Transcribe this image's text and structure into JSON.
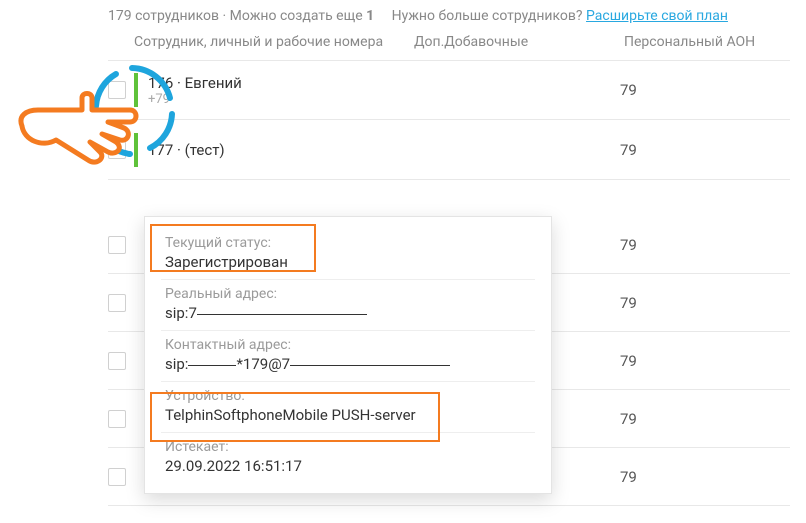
{
  "topInfo": {
    "employees_count": "179 сотрудников",
    "can_create": "Можно создать еще",
    "can_create_num": "1",
    "need_more": "Нужно больше сотрудников?",
    "expand_link": "Расширьте свой план"
  },
  "headers": {
    "employee": "Сотрудник, личный и рабочие номера",
    "ext": "Доп.Добавочные",
    "aon": "Персональный АОН"
  },
  "rows": [
    {
      "title": "176 · Евгений",
      "sub": "+79",
      "aon": "79"
    },
    {
      "title": "177 · (тест)",
      "sub": "",
      "aon": "79"
    }
  ],
  "bg_aon": [
    "79",
    "79",
    "79",
    "79",
    "79"
  ],
  "detail": {
    "status_label": "Текущий статус:",
    "status_value": "Зарегистрирован",
    "real_label": "Реальный адрес:",
    "real_prefix": "sip:7",
    "contact_label": "Контактный адрес:",
    "contact_prefix": "sip:",
    "contact_mid": "*179@7",
    "device_label": "Устройство:",
    "device_value": "TelphinSoftphoneMobile PUSH-server",
    "expires_label": "Истекает:",
    "expires_value": "29.09.2022 16:51:17"
  }
}
